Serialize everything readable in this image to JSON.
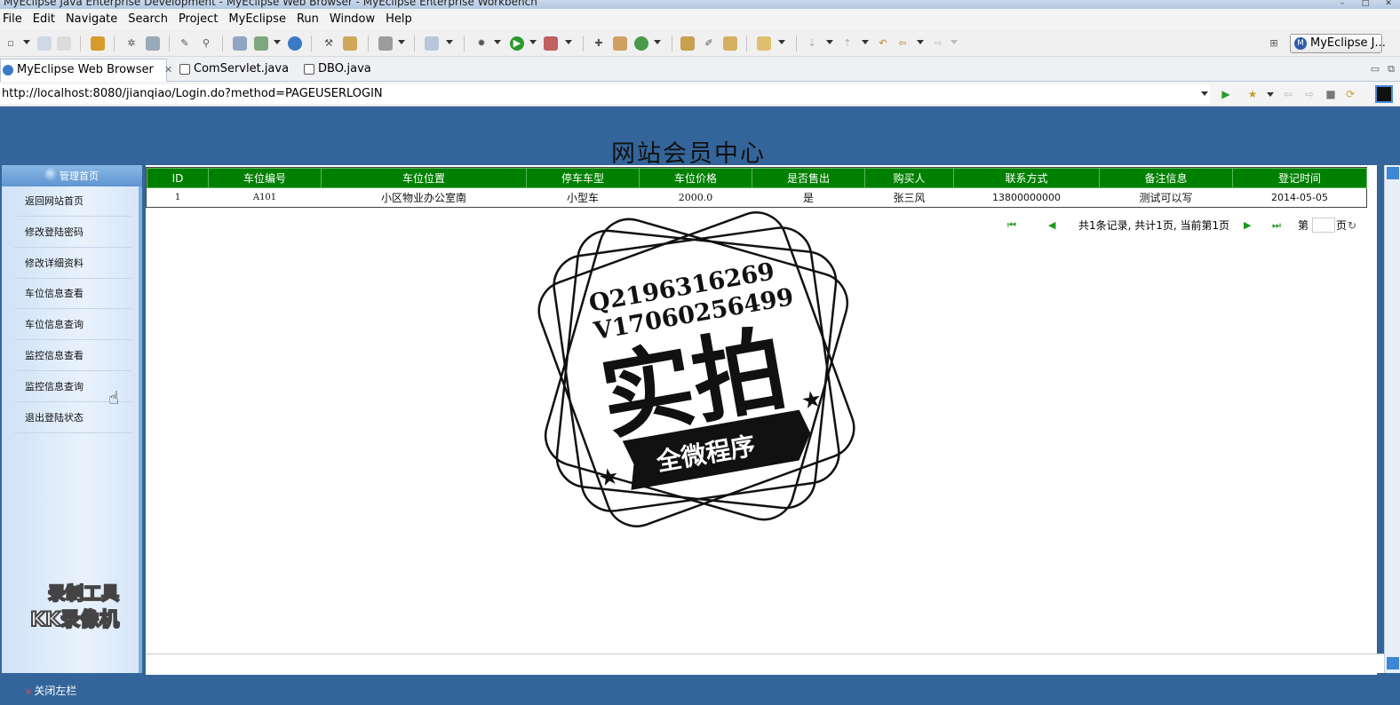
{
  "window": {
    "title": "MyEclipse Java Enterprise Development - MyEclipse Web Browser - MyEclipse Enterprise Workbench",
    "minimize": "–",
    "maximize": "□",
    "close": "✕"
  },
  "menu": [
    "File",
    "Edit",
    "Navigate",
    "Search",
    "Project",
    "MyEclipse",
    "Run",
    "Window",
    "Help"
  ],
  "perspective": {
    "label": "MyEclipse J..."
  },
  "tabs": [
    {
      "label": "MyEclipse Web Browser",
      "close": "✕"
    },
    {
      "label": "ComServlet.java"
    },
    {
      "label": "DBO.java"
    }
  ],
  "browser": {
    "url": "http://localhost:8080/jianqiao/Login.do?method=PAGEUSERLOGIN"
  },
  "page": {
    "title": "网站会员中心",
    "sidebar": {
      "header": "管理首页",
      "items": [
        "返回网站首页",
        "修改登陆密码",
        "修改详细资料",
        "车位信息查看",
        "车位信息查询",
        "监控信息查看",
        "监控信息查询",
        "退出登陆状态"
      ]
    },
    "table": {
      "headers": [
        "ID",
        "车位编号",
        "车位位置",
        "停车车型",
        "车位价格",
        "是否售出",
        "购买人",
        "联系方式",
        "备注信息",
        "登记时间"
      ],
      "rows": [
        [
          "1",
          "A101",
          "小区物业办公室南",
          "小型车",
          "2000.0",
          "是",
          "张三风",
          "13800000000",
          "测试可以写",
          "2014-05-05"
        ]
      ]
    },
    "pager": {
      "first_icon": "⏮",
      "prev_icon": "◀",
      "summary": "共1条记录, 共计1页, 当前第1页",
      "next_icon": "▶",
      "last_icon": "⏭",
      "goto_prefix": "第",
      "goto_suffix": "页",
      "refresh_icon": "↻"
    }
  },
  "stamp": {
    "line1": "Q2196316269",
    "line2": "V17060256499",
    "big": "实拍",
    "banner": "全微程序"
  },
  "watermark": {
    "line1": "录制工具",
    "line2": "KK录像机"
  },
  "status": {
    "close_sidebar": "关闭左栏"
  }
}
